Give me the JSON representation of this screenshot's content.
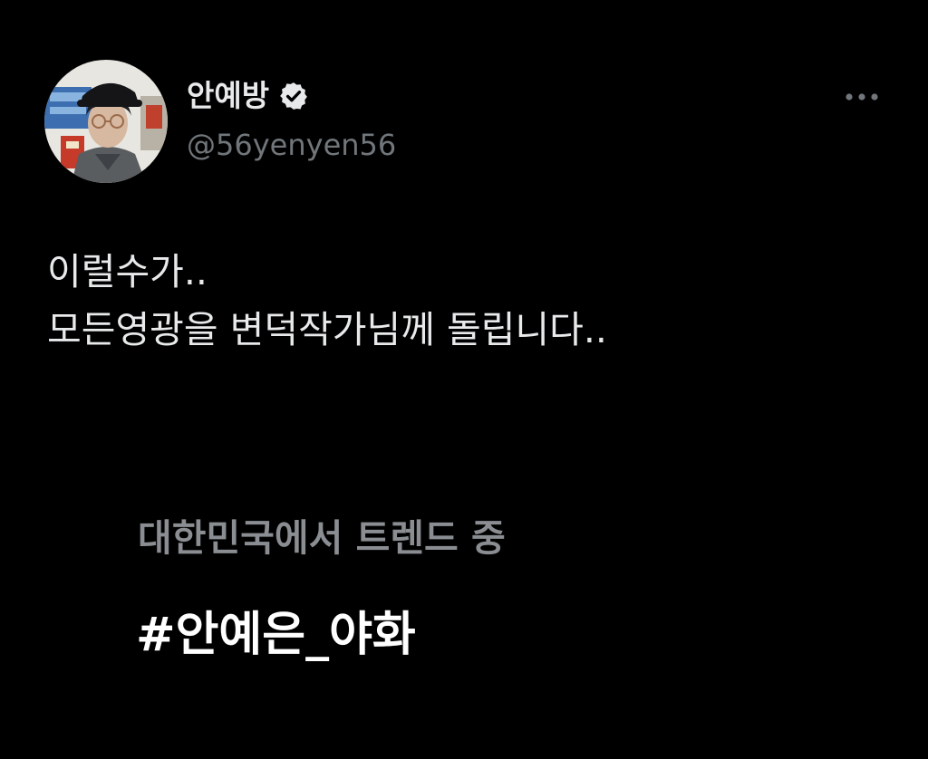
{
  "post": {
    "author": {
      "display_name": "안예방",
      "handle": "@56yenyen56",
      "verified": true,
      "avatar_icon": "profile-photo"
    },
    "more_icon": "more-horizontal-icon",
    "text_lines": [
      "이럴수가..",
      "모든영광을 변덕작가님께 돌립니다.."
    ]
  },
  "media": {
    "trend_context": "대한민국에서 트렌드 중",
    "trend_name": "#안예은_야화"
  },
  "colors": {
    "background": "#000000",
    "primary_text": "#e7e9ea",
    "secondary_text": "#71767b",
    "trend_context_text": "#8a8d91",
    "trend_name_text": "#ffffff"
  }
}
